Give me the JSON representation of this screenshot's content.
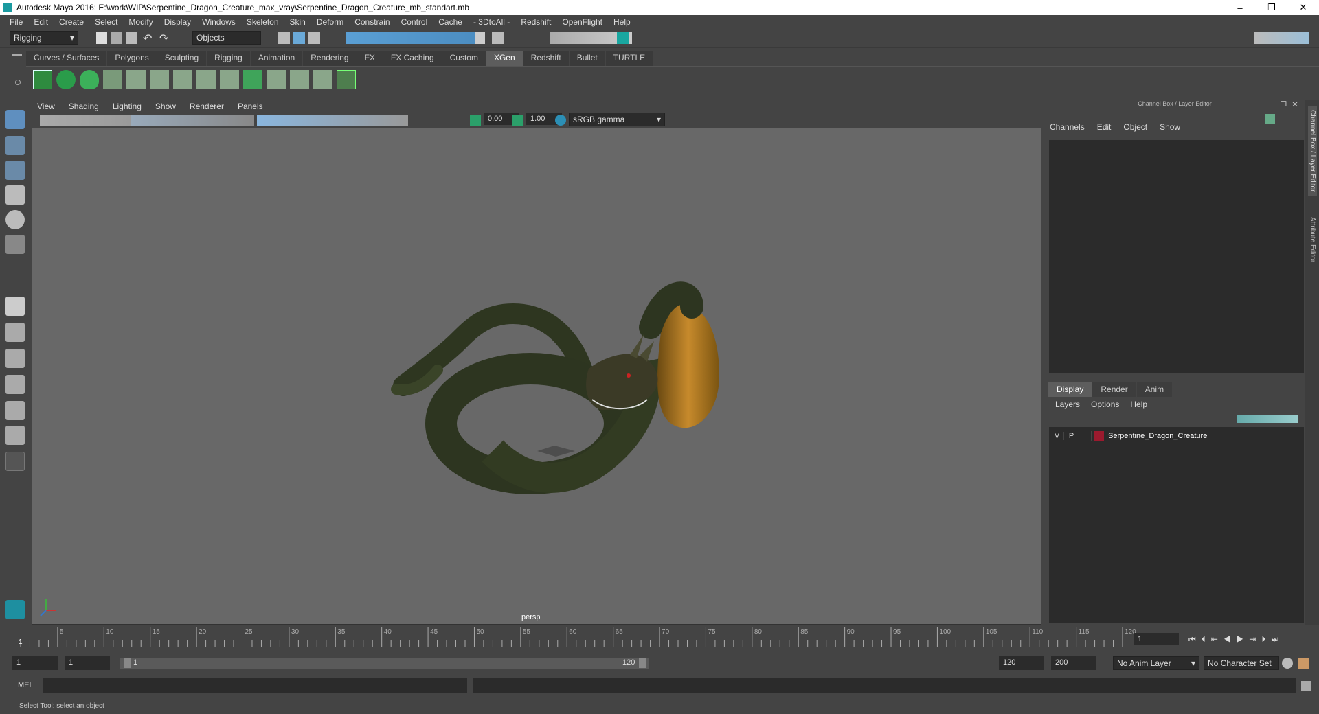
{
  "window": {
    "title": "Autodesk Maya 2016: E:\\work\\WIP\\Serpentine_Dragon_Creature_max_vray\\Serpentine_Dragon_Creature_mb_standart.mb",
    "minimize": "–",
    "maximize": "❐",
    "close": "✕"
  },
  "menubar": [
    "File",
    "Edit",
    "Create",
    "Select",
    "Modify",
    "Display",
    "Windows",
    "Skeleton",
    "Skin",
    "Deform",
    "Constrain",
    "Control",
    "Cache",
    "- 3DtoAll -",
    "Redshift",
    "OpenFlight",
    "Help"
  ],
  "statusline": {
    "mode": "Rigging",
    "selection_mask": "Objects"
  },
  "shelf_tabs": [
    "Curves / Surfaces",
    "Polygons",
    "Sculpting",
    "Rigging",
    "Animation",
    "Rendering",
    "FX",
    "FX Caching",
    "Custom",
    "XGen",
    "Redshift",
    "Bullet",
    "TURTLE"
  ],
  "active_shelf": "XGen",
  "viewport": {
    "menus": [
      "View",
      "Shading",
      "Lighting",
      "Show",
      "Renderer",
      "Panels"
    ],
    "exposure": "0.00",
    "gamma": "1.00",
    "color_space": "sRGB gamma",
    "camera_label": "persp"
  },
  "channel_box": {
    "header": "Channel Box / Layer Editor",
    "menus": [
      "Channels",
      "Edit",
      "Object",
      "Show"
    ]
  },
  "layer_editor": {
    "tabs": [
      "Display",
      "Render",
      "Anim"
    ],
    "active_tab": "Display",
    "menus": [
      "Layers",
      "Options",
      "Help"
    ],
    "layers": [
      {
        "v": "V",
        "p": "P",
        "name": "Serpentine_Dragon_Creature",
        "color": "#9b1a2e"
      }
    ]
  },
  "side_tabs": [
    "Channel Box / Layer Editor",
    "Attribute Editor"
  ],
  "timeline": {
    "ticks": [
      "5",
      "10",
      "15",
      "20",
      "25",
      "30",
      "35",
      "40",
      "45",
      "50",
      "55",
      "60",
      "65",
      "70",
      "75",
      "80",
      "85",
      "90",
      "95",
      "100",
      "105",
      "110",
      "115",
      "120"
    ],
    "first": "1",
    "current_frame": "1"
  },
  "range": {
    "start": "1",
    "playback_start": "1",
    "slider_start": "1",
    "slider_end": "120",
    "playback_end": "120",
    "end": "200",
    "anim_layer": "No Anim Layer",
    "character_set": "No Character Set"
  },
  "cmdline": {
    "label": "MEL"
  },
  "helpline": {
    "text": "Select Tool: select an object"
  }
}
